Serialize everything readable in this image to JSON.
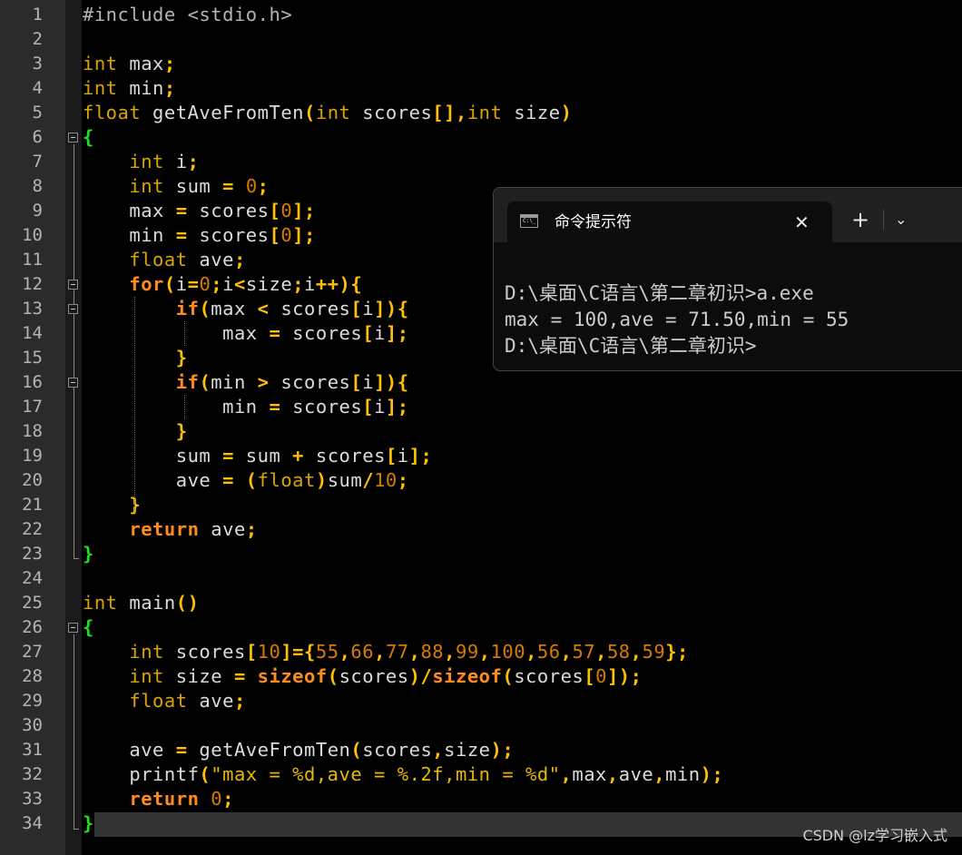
{
  "editor": {
    "line_numbers": [
      "1",
      "2",
      "3",
      "4",
      "5",
      "6",
      "7",
      "8",
      "9",
      "10",
      "11",
      "12",
      "13",
      "14",
      "15",
      "16",
      "17",
      "18",
      "19",
      "20",
      "21",
      "22",
      "23",
      "24",
      "25",
      "26",
      "27",
      "28",
      "29",
      "30",
      "31",
      "32",
      "33",
      "34"
    ],
    "lines": [
      [
        [
          "pre",
          "#include <stdio.h>"
        ]
      ],
      [],
      [
        [
          "type",
          "int"
        ],
        [
          "id",
          " max"
        ],
        [
          "op",
          ";"
        ]
      ],
      [
        [
          "type",
          "int"
        ],
        [
          "id",
          " min"
        ],
        [
          "op",
          ";"
        ]
      ],
      [
        [
          "type",
          "float"
        ],
        [
          "id",
          " getAveFromTen"
        ],
        [
          "op",
          "("
        ],
        [
          "type",
          "int"
        ],
        [
          "id",
          " scores"
        ],
        [
          "op",
          "[],"
        ],
        [
          "type",
          "int"
        ],
        [
          "id",
          " size"
        ],
        [
          "op",
          ")"
        ]
      ],
      [
        [
          "brace",
          "{"
        ]
      ],
      [
        [
          "id",
          "    "
        ],
        [
          "type",
          "int"
        ],
        [
          "id",
          " i"
        ],
        [
          "op",
          ";"
        ]
      ],
      [
        [
          "id",
          "    "
        ],
        [
          "type",
          "int"
        ],
        [
          "id",
          " sum "
        ],
        [
          "op",
          "="
        ],
        [
          "id",
          " "
        ],
        [
          "num",
          "0"
        ],
        [
          "op",
          ";"
        ]
      ],
      [
        [
          "id",
          "    max "
        ],
        [
          "op",
          "="
        ],
        [
          "id",
          " scores"
        ],
        [
          "op",
          "["
        ],
        [
          "num",
          "0"
        ],
        [
          "op",
          "];"
        ]
      ],
      [
        [
          "id",
          "    min "
        ],
        [
          "op",
          "="
        ],
        [
          "id",
          " scores"
        ],
        [
          "op",
          "["
        ],
        [
          "num",
          "0"
        ],
        [
          "op",
          "];"
        ]
      ],
      [
        [
          "id",
          "    "
        ],
        [
          "type",
          "float"
        ],
        [
          "id",
          " ave"
        ],
        [
          "op",
          ";"
        ]
      ],
      [
        [
          "id",
          "    "
        ],
        [
          "ctl",
          "for"
        ],
        [
          "op",
          "("
        ],
        [
          "id",
          "i"
        ],
        [
          "op",
          "="
        ],
        [
          "num",
          "0"
        ],
        [
          "op",
          ";"
        ],
        [
          "id",
          "i"
        ],
        [
          "op",
          "<"
        ],
        [
          "id",
          "size"
        ],
        [
          "op",
          ";"
        ],
        [
          "id",
          "i"
        ],
        [
          "op",
          "++){"
        ]
      ],
      [
        [
          "id",
          "        "
        ],
        [
          "ctl",
          "if"
        ],
        [
          "op",
          "("
        ],
        [
          "id",
          "max "
        ],
        [
          "op",
          "<"
        ],
        [
          "id",
          " scores"
        ],
        [
          "op",
          "["
        ],
        [
          "id",
          "i"
        ],
        [
          "op",
          "]){"
        ]
      ],
      [
        [
          "id",
          "            max "
        ],
        [
          "op",
          "="
        ],
        [
          "id",
          " scores"
        ],
        [
          "op",
          "["
        ],
        [
          "id",
          "i"
        ],
        [
          "op",
          "];"
        ]
      ],
      [
        [
          "id",
          "        "
        ],
        [
          "op",
          "}"
        ]
      ],
      [
        [
          "id",
          "        "
        ],
        [
          "ctl",
          "if"
        ],
        [
          "op",
          "("
        ],
        [
          "id",
          "min "
        ],
        [
          "op",
          ">"
        ],
        [
          "id",
          " scores"
        ],
        [
          "op",
          "["
        ],
        [
          "id",
          "i"
        ],
        [
          "op",
          "]){"
        ]
      ],
      [
        [
          "id",
          "            min "
        ],
        [
          "op",
          "="
        ],
        [
          "id",
          " scores"
        ],
        [
          "op",
          "["
        ],
        [
          "id",
          "i"
        ],
        [
          "op",
          "];"
        ]
      ],
      [
        [
          "id",
          "        "
        ],
        [
          "op",
          "}"
        ]
      ],
      [
        [
          "id",
          "        sum "
        ],
        [
          "op",
          "="
        ],
        [
          "id",
          " sum "
        ],
        [
          "op",
          "+"
        ],
        [
          "id",
          " scores"
        ],
        [
          "op",
          "["
        ],
        [
          "id",
          "i"
        ],
        [
          "op",
          "];"
        ]
      ],
      [
        [
          "id",
          "        ave "
        ],
        [
          "op",
          "="
        ],
        [
          "id",
          " "
        ],
        [
          "op",
          "("
        ],
        [
          "type",
          "float"
        ],
        [
          "op",
          ")"
        ],
        [
          "id",
          "sum"
        ],
        [
          "op",
          "/"
        ],
        [
          "num",
          "10"
        ],
        [
          "op",
          ";"
        ]
      ],
      [
        [
          "id",
          "    "
        ],
        [
          "op",
          "}"
        ]
      ],
      [
        [
          "id",
          "    "
        ],
        [
          "ctl",
          "return"
        ],
        [
          "id",
          " ave"
        ],
        [
          "op",
          ";"
        ]
      ],
      [
        [
          "brace",
          "}"
        ]
      ],
      [],
      [
        [
          "type",
          "int"
        ],
        [
          "id",
          " main"
        ],
        [
          "op",
          "()"
        ]
      ],
      [
        [
          "brace",
          "{"
        ]
      ],
      [
        [
          "id",
          "    "
        ],
        [
          "type",
          "int"
        ],
        [
          "id",
          " scores"
        ],
        [
          "op",
          "["
        ],
        [
          "num",
          "10"
        ],
        [
          "op",
          "]={"
        ],
        [
          "num",
          "55"
        ],
        [
          "op",
          ","
        ],
        [
          "num",
          "66"
        ],
        [
          "op",
          ","
        ],
        [
          "num",
          "77"
        ],
        [
          "op",
          ","
        ],
        [
          "num",
          "88"
        ],
        [
          "op",
          ","
        ],
        [
          "num",
          "99"
        ],
        [
          "op",
          ","
        ],
        [
          "num",
          "100"
        ],
        [
          "op",
          ","
        ],
        [
          "num",
          "56"
        ],
        [
          "op",
          ","
        ],
        [
          "num",
          "57"
        ],
        [
          "op",
          ","
        ],
        [
          "num",
          "58"
        ],
        [
          "op",
          ","
        ],
        [
          "num",
          "59"
        ],
        [
          "op",
          "};"
        ]
      ],
      [
        [
          "id",
          "    "
        ],
        [
          "type",
          "int"
        ],
        [
          "id",
          " size "
        ],
        [
          "op",
          "="
        ],
        [
          "id",
          " "
        ],
        [
          "ctl",
          "sizeof"
        ],
        [
          "op",
          "("
        ],
        [
          "id",
          "scores"
        ],
        [
          "op",
          ")/"
        ],
        [
          "ctl",
          "sizeof"
        ],
        [
          "op",
          "("
        ],
        [
          "id",
          "scores"
        ],
        [
          "op",
          "["
        ],
        [
          "num",
          "0"
        ],
        [
          "op",
          "]);"
        ]
      ],
      [
        [
          "id",
          "    "
        ],
        [
          "type",
          "float"
        ],
        [
          "id",
          " ave"
        ],
        [
          "op",
          ";"
        ]
      ],
      [],
      [
        [
          "id",
          "    ave "
        ],
        [
          "op",
          "="
        ],
        [
          "id",
          " getAveFromTen"
        ],
        [
          "op",
          "("
        ],
        [
          "id",
          "scores"
        ],
        [
          "op",
          ","
        ],
        [
          "id",
          "size"
        ],
        [
          "op",
          ");"
        ]
      ],
      [
        [
          "id",
          "    printf"
        ],
        [
          "op",
          "("
        ],
        [
          "str",
          "\"max = %d,ave = %.2f,min = %d\""
        ],
        [
          "op",
          ","
        ],
        [
          "id",
          "max"
        ],
        [
          "op",
          ","
        ],
        [
          "id",
          "ave"
        ],
        [
          "op",
          ","
        ],
        [
          "id",
          "min"
        ],
        [
          "op",
          ");"
        ]
      ],
      [
        [
          "id",
          "    "
        ],
        [
          "ctl",
          "return"
        ],
        [
          "id",
          " "
        ],
        [
          "num",
          "0"
        ],
        [
          "op",
          ";"
        ]
      ],
      [
        [
          "brace",
          "}"
        ]
      ]
    ],
    "fold_markers": [
      6,
      12,
      13,
      16,
      26
    ]
  },
  "terminal": {
    "tab_title": "命令提示符",
    "tab_icon_text": "C:\\_",
    "close_glyph": "✕",
    "new_tab_glyph": "+",
    "dropdown_glyph": "⌄",
    "output_lines": [
      "D:\\桌面\\C语言\\第二章初识>a.exe",
      "max = 100,ave = 71.50,min = 55",
      "D:\\桌面\\C语言\\第二章初识>"
    ]
  },
  "watermark": "CSDN @lz学习嵌入式",
  "colors": {
    "background": "#000000",
    "gutter": "#2b2b2b",
    "keyword_type": "#d9a400",
    "keyword_control": "#ff8c1a",
    "operator": "#ffc000",
    "number": "#d97a00",
    "brace": "#22e022",
    "terminal_bg": "#0c0c0c",
    "terminal_titlebar": "#202020"
  }
}
